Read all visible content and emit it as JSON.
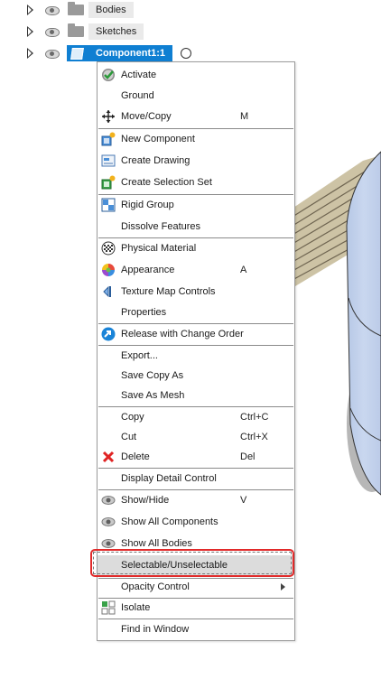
{
  "tree": {
    "rows": [
      {
        "label": "Bodies"
      },
      {
        "label": "Sketches"
      },
      {
        "label": "Component1:1"
      }
    ]
  },
  "menu": {
    "items": [
      {
        "label": "Activate",
        "icon": "activate-check-icon"
      },
      {
        "label": "Ground"
      },
      {
        "label": "Move/Copy",
        "shortcut": "M",
        "icon": "move-arrows-icon"
      },
      {
        "label": "New Component",
        "icon": "new-component-icon"
      },
      {
        "label": "Create Drawing",
        "icon": "create-drawing-icon"
      },
      {
        "label": "Create Selection Set",
        "icon": "selection-set-icon"
      },
      {
        "label": "Rigid Group",
        "icon": "rigid-group-icon"
      },
      {
        "label": "Dissolve Features"
      },
      {
        "label": "Physical Material",
        "icon": "physical-material-icon"
      },
      {
        "label": "Appearance",
        "shortcut": "A",
        "icon": "appearance-icon"
      },
      {
        "label": "Texture Map Controls",
        "icon": "texture-map-icon"
      },
      {
        "label": "Properties"
      },
      {
        "label": "Release with Change Order",
        "icon": "release-change-order-icon"
      },
      {
        "label": "Export..."
      },
      {
        "label": "Save Copy As"
      },
      {
        "label": "Save As Mesh"
      },
      {
        "label": "Copy",
        "shortcut": "Ctrl+C"
      },
      {
        "label": "Cut",
        "shortcut": "Ctrl+X"
      },
      {
        "label": "Delete",
        "shortcut": "Del",
        "icon": "delete-x-icon"
      },
      {
        "label": "Display Detail Control"
      },
      {
        "label": "Show/Hide",
        "shortcut": "V",
        "icon": "eye-icon"
      },
      {
        "label": "Show All Components",
        "icon": "eye-icon"
      },
      {
        "label": "Show All Bodies",
        "icon": "eye-icon"
      },
      {
        "label": "Selectable/Unselectable"
      },
      {
        "label": "Opacity Control"
      },
      {
        "label": "Isolate",
        "icon": "isolate-icon"
      },
      {
        "label": "Find in Window"
      }
    ]
  },
  "colors": {
    "selection_blue": "#0f7fd2",
    "highlight_red": "#e12a2a",
    "model_blue": "#c5d5ee",
    "model_tan": "#cfc5a8"
  }
}
